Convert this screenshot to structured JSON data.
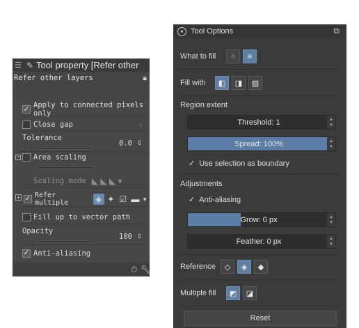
{
  "left_panel": {
    "title": "Tool property [Refer other",
    "subheader": "Refer other layers",
    "apply_connected": "Apply to connected pixels only",
    "close_gap": "Close gap",
    "tolerance_label": "Tolerance",
    "tolerance_value": "0.0",
    "area_scaling": "Area scaling",
    "scaling_mode": "Scaling mode",
    "refer_multiple": "Refer multiple",
    "fill_up_vector": "Fill up to vector path",
    "opacity_label": "Opacity",
    "opacity_value": "100",
    "anti_aliasing": "Anti-aliasing"
  },
  "right_panel": {
    "title": "Tool Options",
    "what_to_fill": "What to fill",
    "fill_with": "Fill with",
    "region_extent": "Region extent",
    "threshold": "Threshold: 1",
    "spread": "Spread: 100%",
    "spread_fraction": 1.0,
    "use_selection": "Use selection as boundary",
    "adjustments": "Adjustments",
    "anti_aliasing": "Anti-aliasing",
    "grow": "Grow: 0 px",
    "grow_fraction": 0.38,
    "feather": "Feather: 0 px",
    "reference": "Reference",
    "multiple_fill": "Multiple fill",
    "reset": "Reset"
  },
  "colors": {
    "accent": "#5c7ea6",
    "panel_dark": "#3b3b3b",
    "panel_mid": "#474747"
  }
}
